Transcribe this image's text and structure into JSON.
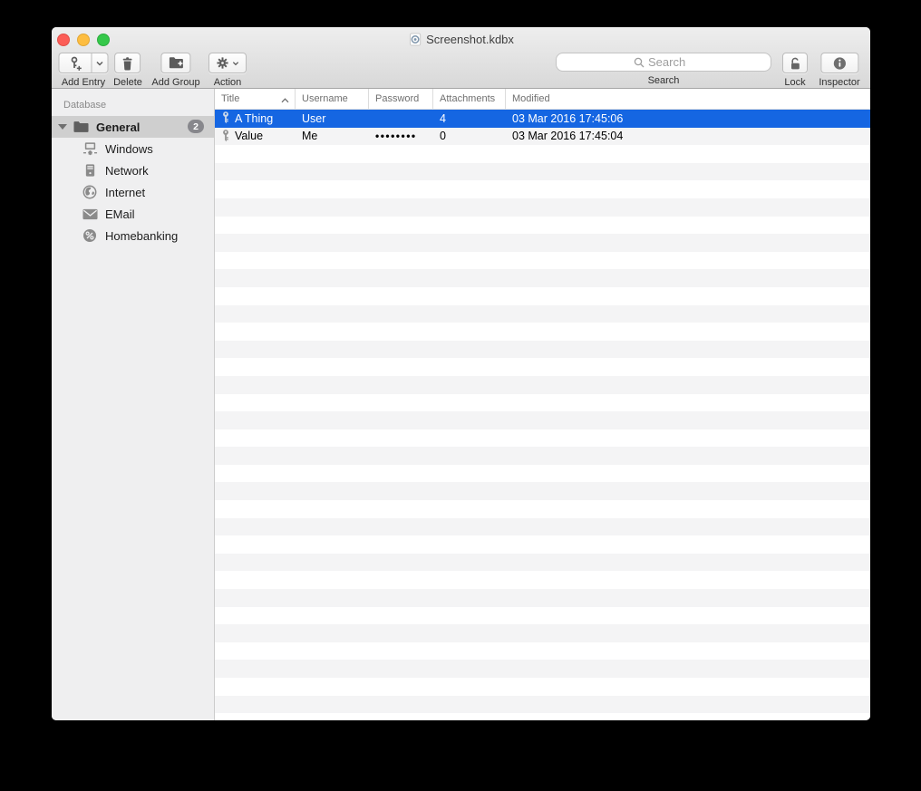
{
  "window": {
    "title": "Screenshot.kdbx"
  },
  "toolbar": {
    "add_entry_label": "Add Entry",
    "delete_label": "Delete",
    "add_group_label": "Add Group",
    "action_label": "Action",
    "search_placeholder": "Search",
    "search_label": "Search",
    "lock_label": "Lock",
    "inspector_label": "Inspector"
  },
  "sidebar": {
    "section": "Database",
    "groups": [
      {
        "label": "General",
        "badge": "2",
        "icon": "folder-icon",
        "selected": true,
        "expanded": true
      },
      {
        "label": "Windows",
        "icon": "windows-icon"
      },
      {
        "label": "Network",
        "icon": "server-icon"
      },
      {
        "label": "Internet",
        "icon": "globe-icon"
      },
      {
        "label": "EMail",
        "icon": "envelope-icon"
      },
      {
        "label": "Homebanking",
        "icon": "percent-icon"
      }
    ]
  },
  "table": {
    "columns": {
      "title": "Title",
      "username": "Username",
      "password": "Password",
      "attachments": "Attachments",
      "modified": "Modified"
    },
    "sort": {
      "column": "Title",
      "direction": "ascending"
    },
    "rows": [
      {
        "title": "A Thing",
        "username": "User",
        "password": "",
        "attachments": "4",
        "modified": "03 Mar 2016 17:45:06",
        "selected": true
      },
      {
        "title": "Value",
        "username": "Me",
        "password": "••••••••",
        "attachments": "0",
        "modified": "03 Mar 2016 17:45:04",
        "selected": false
      }
    ]
  },
  "colors": {
    "selection_blue": "#1566e2",
    "stripe_gray": "#f4f4f5",
    "sidebar_selection": "#cfcfcf",
    "toolbar_icon": "#5b5b5b",
    "sidebar_icon": "#8a8a8a"
  }
}
